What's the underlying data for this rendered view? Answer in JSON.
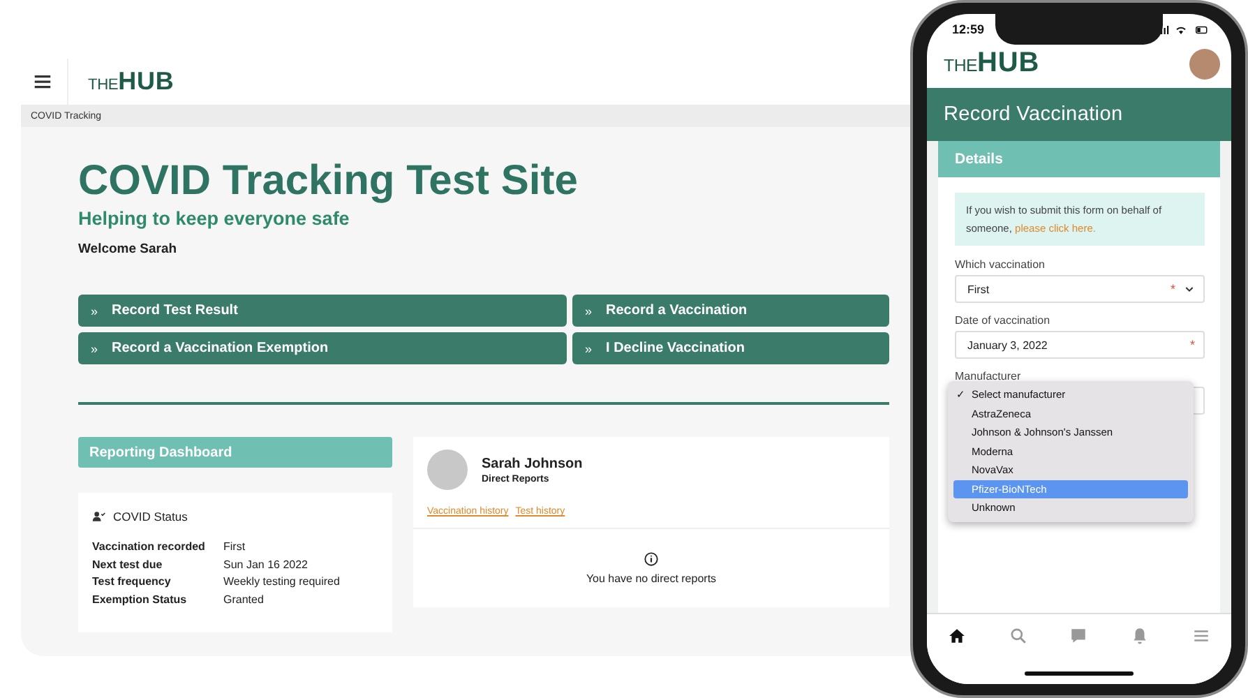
{
  "desktop": {
    "logo": {
      "prefix": "THE",
      "main": "HUB"
    },
    "breadcrumb": "COVID Tracking",
    "title": "COVID Tracking Test Site",
    "subtitle": "Helping to keep everyone safe",
    "welcome": "Welcome Sarah",
    "actions": [
      {
        "icon": "»",
        "label": "Record Test Result"
      },
      {
        "icon": "»",
        "label": "Record a Vaccination"
      },
      {
        "icon": "»",
        "label": "Record a Vaccination Exemption"
      },
      {
        "icon": "»",
        "label": "I Decline Vaccination"
      }
    ],
    "dashboard_title": "Reporting Dashboard",
    "status_card": {
      "title": "COVID Status",
      "rows": [
        {
          "label": "Vaccination recorded",
          "value": "First"
        },
        {
          "label": "Next test due",
          "value": "Sun Jan 16 2022"
        },
        {
          "label": "Test frequency",
          "value": "Weekly testing required"
        },
        {
          "label": "Exemption Status",
          "value": "Granted"
        }
      ]
    },
    "profile_card": {
      "name": "Sarah Johnson",
      "role": "Direct Reports",
      "links": [
        "Vaccination history",
        "Test history"
      ],
      "message": "You have no direct reports"
    }
  },
  "phone": {
    "time": "12:59",
    "logo": {
      "prefix": "THE",
      "main": "HUB"
    },
    "page_title": "Record Vaccination",
    "section_title": "Details",
    "notice": {
      "text": "If you wish to submit this form on behalf of someone, ",
      "link": "please click here."
    },
    "required_mark": "*",
    "check_mark": "✓",
    "fields": [
      {
        "label": "Which vaccination",
        "kind": "select",
        "value": "First",
        "required": true
      },
      {
        "label": "Date of vaccination",
        "kind": "date",
        "value": "January 3, 2022",
        "required": true
      },
      {
        "label": "Manufacturer",
        "kind": "select",
        "required": false
      }
    ],
    "dropdown": [
      {
        "label": "Select manufacturer",
        "checked": true,
        "highlighted": false
      },
      {
        "label": "AstraZeneca",
        "checked": false,
        "highlighted": false
      },
      {
        "label": "Johnson & Johnson's Janssen",
        "checked": false,
        "highlighted": false
      },
      {
        "label": "Moderna",
        "checked": false,
        "highlighted": false
      },
      {
        "label": "NovaVax",
        "checked": false,
        "highlighted": false
      },
      {
        "label": "Pfizer-BioNTech",
        "checked": false,
        "highlighted": true
      },
      {
        "label": "Unknown",
        "checked": false,
        "highlighted": false
      }
    ],
    "nav": [
      {
        "kind": "home",
        "selected": true
      },
      {
        "kind": "search",
        "selected": false
      },
      {
        "kind": "chat",
        "selected": false
      },
      {
        "kind": "bell",
        "selected": false
      },
      {
        "kind": "menu",
        "selected": false
      }
    ]
  }
}
